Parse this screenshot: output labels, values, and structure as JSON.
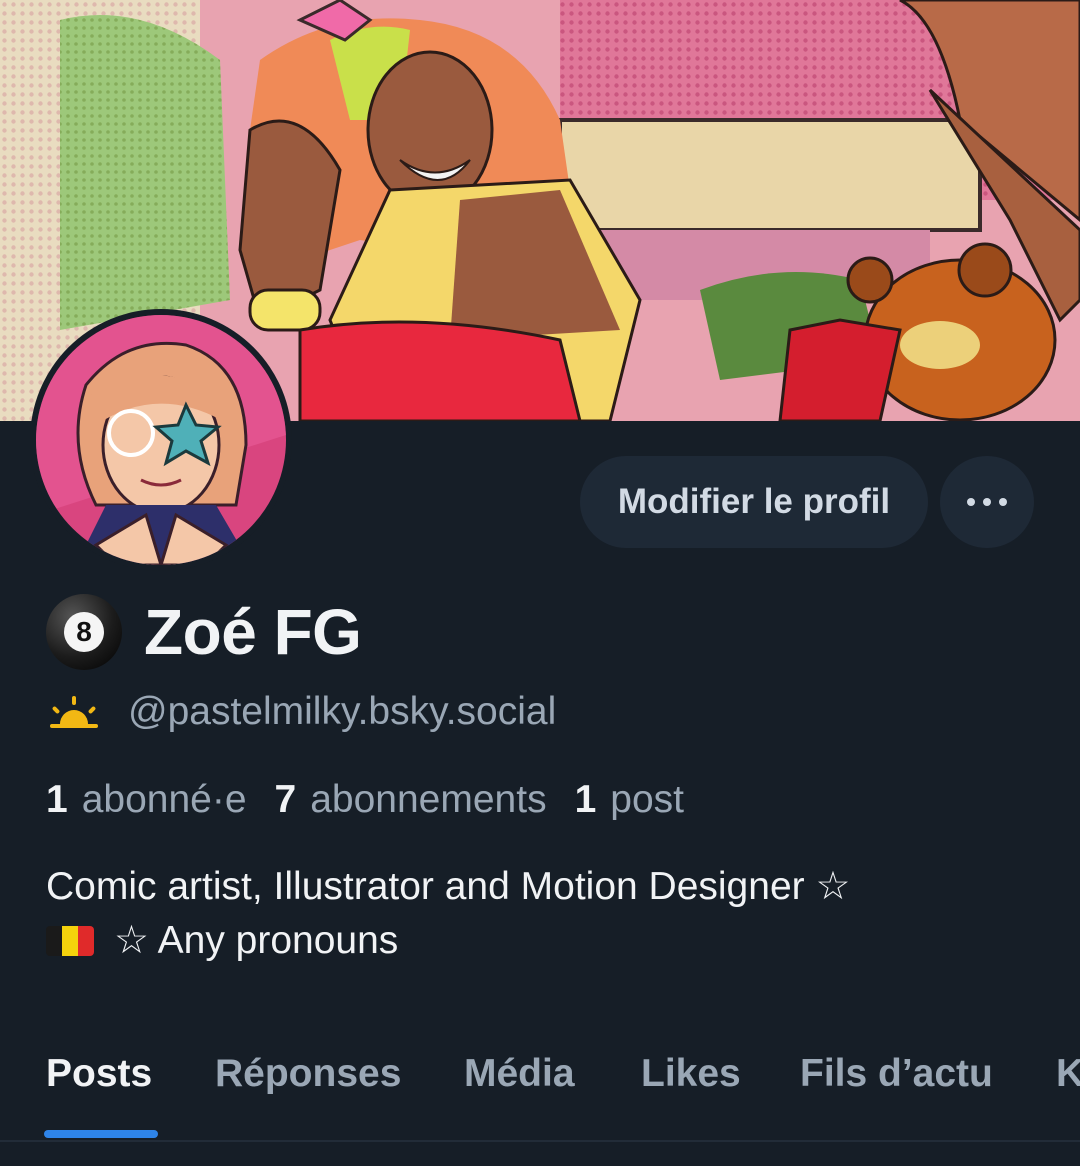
{
  "profile": {
    "display_name": "Zoé FG",
    "name_emoji_icon": "8-ball-icon",
    "handle_emoji_icon": "sunrise-icon",
    "handle": "@pastelmilky.bsky.social",
    "bio_line1": "Comic artist, Illustrator and Motion Designer ☆",
    "bio_line2_rest": "☆ Any pronouns",
    "bio_flag_icon": "belgium-flag-icon"
  },
  "stats": {
    "followers_count": "1",
    "followers_label": "abonné·e",
    "following_count": "7",
    "following_label": "abonnements",
    "posts_count": "1",
    "posts_label": "post"
  },
  "actions": {
    "edit_profile_label": "Modifier le profil",
    "more_icon": "more-horizontal-icon"
  },
  "tabs": [
    {
      "label": "Posts",
      "active": true
    },
    {
      "label": "Réponses",
      "active": false
    },
    {
      "label": "Média",
      "active": false
    },
    {
      "label": "Likes",
      "active": false
    },
    {
      "label": "Fils d’actu",
      "active": false
    },
    {
      "label": "K",
      "active": false
    }
  ],
  "colors": {
    "background": "#161e27",
    "button_bg": "#1e2936",
    "accent": "#2e84e8",
    "muted_text": "#9aa7b5"
  }
}
